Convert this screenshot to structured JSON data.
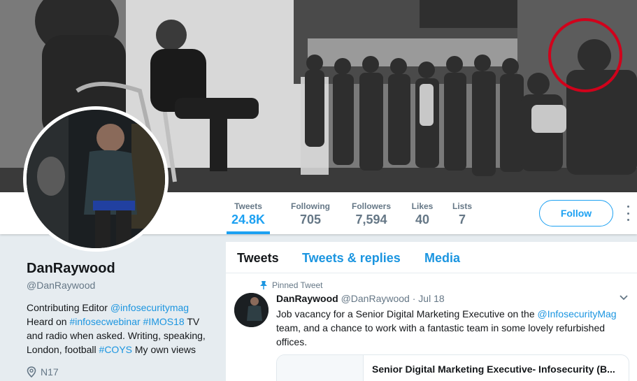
{
  "stats": {
    "tweets": {
      "label": "Tweets",
      "value": "24.8K"
    },
    "following": {
      "label": "Following",
      "value": "705"
    },
    "followers": {
      "label": "Followers",
      "value": "7,594"
    },
    "likes": {
      "label": "Likes",
      "value": "40"
    },
    "lists": {
      "label": "Lists",
      "value": "7"
    }
  },
  "follow_label": "Follow",
  "profile": {
    "name": "DanRaywood",
    "handle": "@DanRaywood",
    "bio": {
      "line1_text": "Contributing Editor ",
      "line1_link": "@infosecuritymag",
      "line2_text": "Heard on ",
      "line2_link1": "#infosecwebinar",
      "line2_link2": "#IMOS18",
      "line2_after": " TV",
      "line3": "and radio when asked. Writing, speaking,",
      "line4_text": "London, football ",
      "line4_link": "#COYS",
      "line4_after": " My own views"
    },
    "location": "N17"
  },
  "tabs": [
    "Tweets",
    "Tweets & replies",
    "Media"
  ],
  "tweet": {
    "pinned_label": "Pinned Tweet",
    "author": "DanRaywood",
    "handle_date": "@DanRaywood · Jul 18",
    "text_before": "Job vacancy for a Senior Digital Marketing Executive on the ",
    "text_link": "@InfosecurityMag",
    "text_after": " team, and a chance to work with a fantastic team in some lovely refurbished offices.",
    "card_title": "Senior Digital Marketing Executive- Infosecurity (B..."
  },
  "icons": {
    "pin": "pin-icon",
    "location": "location-pin-icon",
    "chevron": "chevron-down-icon",
    "more": "more-vertical-icon"
  },
  "colors": {
    "accent": "#1da1f2",
    "link": "#1b95e0",
    "muted": "#657786",
    "page_bg": "#e6ecf0"
  }
}
